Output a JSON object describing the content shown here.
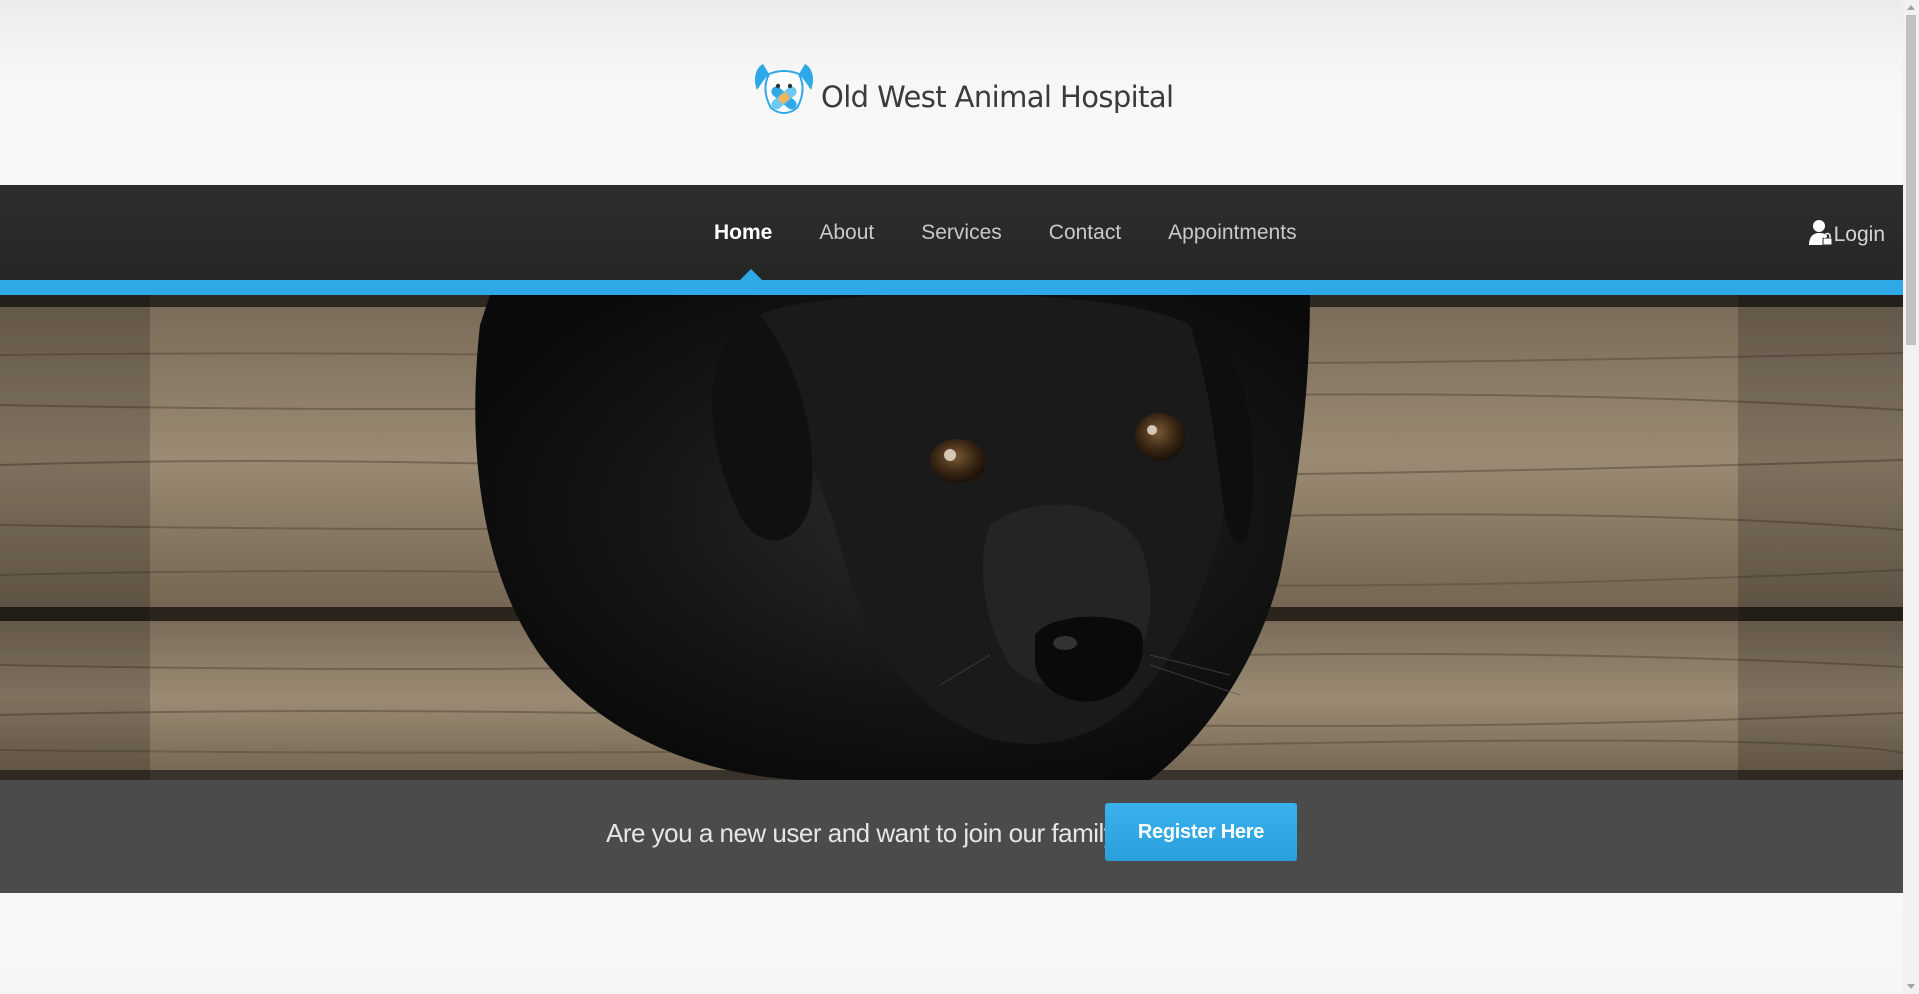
{
  "site": {
    "name": "Old West Animal Hospital"
  },
  "nav": {
    "items": [
      {
        "label": "Home",
        "active": true
      },
      {
        "label": "About",
        "active": false
      },
      {
        "label": "Services",
        "active": false
      },
      {
        "label": "Contact",
        "active": false
      },
      {
        "label": "Appointments",
        "active": false
      }
    ],
    "login_label": "Login",
    "login_icon": "user-lock-icon"
  },
  "hero": {
    "image": "black-labrador-puppy-on-wooden-deck"
  },
  "cta": {
    "text": "Are you a new user and want to join our family?",
    "button_label": "Register Here"
  },
  "colors": {
    "accent": "#2ea8e6",
    "nav_bg": "#2a2a2a",
    "cta_bg": "#4b4b4b"
  }
}
